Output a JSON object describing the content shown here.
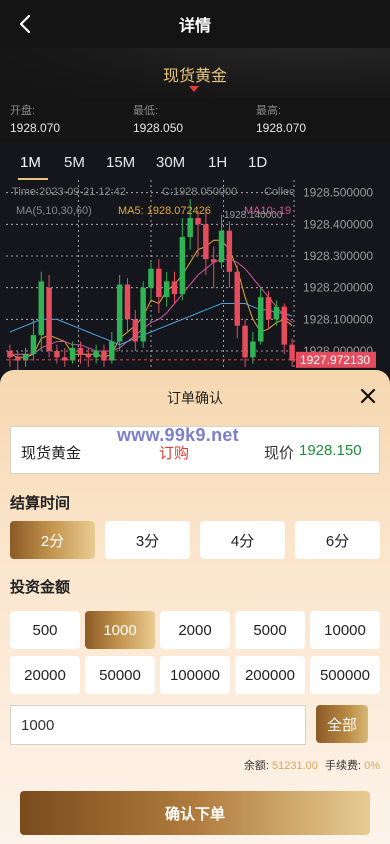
{
  "header": {
    "title": "详情"
  },
  "product": {
    "name": "现货黄金"
  },
  "stats": [
    {
      "label": "开盘:",
      "value": "1928.070"
    },
    {
      "label": "最低:",
      "value": "1928.050"
    },
    {
      "label": "最高:",
      "value": "1928.070"
    }
  ],
  "timeframes": [
    "1M",
    "5M",
    "15M",
    "30M",
    "1H",
    "1D"
  ],
  "active_timeframe": "1M",
  "chart_info": {
    "time": "Time:2023-09-21 12:42",
    "close": "C:1928.050000",
    "collect": "Collec",
    "ma_label": "MA(5,10,30,60)",
    "ma5": "MA5: 1928.072426",
    "ma10": "MA10: 19",
    "hover_value": "1928.140000",
    "last_price_tag": "1927.972130"
  },
  "chart_data": {
    "type": "candlestick",
    "y_ticks": [
      "1928.500000",
      "1928.400000",
      "1928.300000",
      "1928.200000",
      "1928.100000",
      "1928.000000"
    ],
    "ylim": [
      1927.94,
      1928.54
    ],
    "last_price": 1927.97213,
    "candles": [
      {
        "o": 1928.0,
        "c": 1927.98,
        "h": 1928.02,
        "l": 1927.95
      },
      {
        "o": 1927.98,
        "c": 1927.97,
        "h": 1928.0,
        "l": 1927.94
      },
      {
        "o": 1927.97,
        "c": 1927.99,
        "h": 1928.01,
        "l": 1927.95
      },
      {
        "o": 1927.99,
        "c": 1928.05,
        "h": 1928.1,
        "l": 1927.97
      },
      {
        "o": 1928.05,
        "c": 1928.22,
        "h": 1928.25,
        "l": 1928.0
      },
      {
        "o": 1928.2,
        "c": 1928.0,
        "h": 1928.24,
        "l": 1927.98
      },
      {
        "o": 1928.0,
        "c": 1927.98,
        "h": 1928.02,
        "l": 1927.96
      },
      {
        "o": 1927.98,
        "c": 1927.97,
        "h": 1928.01,
        "l": 1927.95
      },
      {
        "o": 1927.97,
        "c": 1928.01,
        "h": 1928.03,
        "l": 1927.96
      },
      {
        "o": 1928.01,
        "c": 1927.99,
        "h": 1928.03,
        "l": 1927.96
      },
      {
        "o": 1927.99,
        "c": 1927.98,
        "h": 1928.01,
        "l": 1927.95
      },
      {
        "o": 1927.98,
        "c": 1928.0,
        "h": 1928.02,
        "l": 1927.96
      },
      {
        "o": 1928.0,
        "c": 1927.97,
        "h": 1928.02,
        "l": 1927.95
      },
      {
        "o": 1927.97,
        "c": 1928.03,
        "h": 1928.06,
        "l": 1927.96
      },
      {
        "o": 1928.03,
        "c": 1928.21,
        "h": 1928.24,
        "l": 1928.0
      },
      {
        "o": 1928.21,
        "c": 1928.1,
        "h": 1928.23,
        "l": 1928.06
      },
      {
        "o": 1928.1,
        "c": 1928.03,
        "h": 1928.13,
        "l": 1928.0
      },
      {
        "o": 1928.03,
        "c": 1928.2,
        "h": 1928.22,
        "l": 1928.01
      },
      {
        "o": 1928.2,
        "c": 1928.26,
        "h": 1928.28,
        "l": 1928.16
      },
      {
        "o": 1928.26,
        "c": 1928.17,
        "h": 1928.29,
        "l": 1928.12
      },
      {
        "o": 1928.17,
        "c": 1928.22,
        "h": 1928.25,
        "l": 1928.14
      },
      {
        "o": 1928.22,
        "c": 1928.18,
        "h": 1928.25,
        "l": 1928.15
      },
      {
        "o": 1928.18,
        "c": 1928.36,
        "h": 1928.42,
        "l": 1928.16
      },
      {
        "o": 1928.36,
        "c": 1928.42,
        "h": 1928.48,
        "l": 1928.32
      },
      {
        "o": 1928.42,
        "c": 1928.4,
        "h": 1928.44,
        "l": 1928.3
      },
      {
        "o": 1928.4,
        "c": 1928.29,
        "h": 1928.45,
        "l": 1928.24
      },
      {
        "o": 1928.29,
        "c": 1928.28,
        "h": 1928.33,
        "l": 1928.2
      },
      {
        "o": 1928.28,
        "c": 1928.38,
        "h": 1928.43,
        "l": 1928.26
      },
      {
        "o": 1928.38,
        "c": 1928.25,
        "h": 1928.41,
        "l": 1928.2
      },
      {
        "o": 1928.25,
        "c": 1928.08,
        "h": 1928.27,
        "l": 1928.04
      },
      {
        "o": 1928.08,
        "c": 1927.98,
        "h": 1928.1,
        "l": 1927.95
      },
      {
        "o": 1927.98,
        "c": 1928.03,
        "h": 1928.06,
        "l": 1927.96
      },
      {
        "o": 1928.03,
        "c": 1928.17,
        "h": 1928.2,
        "l": 1928.02
      },
      {
        "o": 1928.17,
        "c": 1928.1,
        "h": 1928.19,
        "l": 1928.07
      },
      {
        "o": 1928.1,
        "c": 1928.14,
        "h": 1928.16,
        "l": 1928.08
      },
      {
        "o": 1928.14,
        "c": 1928.02,
        "h": 1928.15,
        "l": 1927.99
      },
      {
        "o": 1928.02,
        "c": 1927.97,
        "h": 1928.04,
        "l": 1927.95
      }
    ],
    "ma_lines": [
      {
        "color": "#e0a93b",
        "values": [
          1927.99,
          1927.98,
          1927.98,
          1927.99,
          1928.04,
          1928.05,
          1928.04,
          1928.03,
          1927.99,
          1927.99,
          1927.99,
          1927.99,
          1927.98,
          1927.99,
          1928.04,
          1928.06,
          1928.08,
          1928.11,
          1928.16,
          1928.15,
          1928.19,
          1928.21,
          1928.24,
          1928.28,
          1928.32,
          1928.33,
          1928.35,
          1928.35,
          1928.32,
          1928.26,
          1928.17,
          1928.1,
          1928.06,
          1928.07,
          1928.09,
          1928.1,
          1928.08
        ]
      },
      {
        "color": "#d0579b",
        "values": [
          1927.99,
          1927.99,
          1927.99,
          1927.99,
          1928.01,
          1928.02,
          1928.03,
          1928.03,
          1928.02,
          1928.02,
          1928.01,
          1928.0,
          1928.0,
          1928.0,
          1928.01,
          1928.03,
          1928.05,
          1928.07,
          1928.09,
          1928.1,
          1928.12,
          1928.15,
          1928.18,
          1928.21,
          1928.24,
          1928.26,
          1928.28,
          1928.29,
          1928.29,
          1928.28,
          1928.26,
          1928.23,
          1928.2,
          1928.17,
          1928.14,
          1928.11,
          1928.09
        ]
      },
      {
        "color": "#4fa3e0",
        "values": [
          1928.06,
          1928.07,
          1928.08,
          1928.09,
          1928.1,
          1928.1,
          1928.1,
          1928.09,
          1928.08,
          1928.07,
          1928.06,
          1928.05,
          1928.04,
          1928.03,
          1928.02,
          1928.03,
          1928.04,
          1928.05,
          1928.06,
          1928.07,
          1928.08,
          1928.09,
          1928.1,
          1928.11,
          1928.12,
          1928.13,
          1928.14,
          1928.15,
          1928.15,
          1928.15,
          1928.15,
          1928.14,
          1928.13,
          1928.13,
          1928.12,
          1928.12,
          1928.11
        ]
      }
    ]
  },
  "order_sheet": {
    "title": "订单确认",
    "watermark": "www.99k9.net",
    "product_name": "现货黄金",
    "action": "订购",
    "price_label": "现价",
    "price": "1928.150",
    "settle_label": "结算时间",
    "settle_options": [
      "2分",
      "3分",
      "4分",
      "6分"
    ],
    "settle_selected": "2分",
    "amount_label": "投资金额",
    "amount_options": [
      "500",
      "1000",
      "2000",
      "5000",
      "10000",
      "20000",
      "50000",
      "100000",
      "200000",
      "500000"
    ],
    "amount_selected": "1000",
    "amount_value": "1000",
    "all_label": "全部",
    "balance_label": "余额:",
    "balance_value": "51231.00",
    "fee_label": "手续费:",
    "fee_value": "0%",
    "confirm_label": "确认下单"
  },
  "colors": {
    "accent": "#e7c57d",
    "up": "#2fb354",
    "down": "#e54d5f",
    "price_green": "#1a8f3a"
  }
}
